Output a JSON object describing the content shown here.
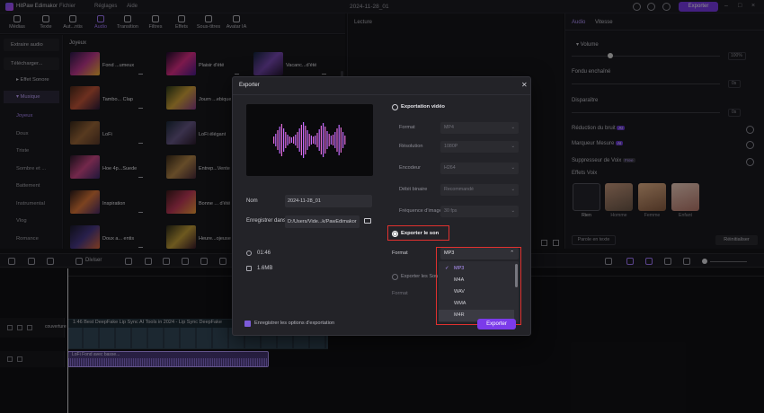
{
  "app": {
    "name": "HitPaw Edimakor",
    "menus": [
      "Fichier",
      "Réglages",
      "Aide"
    ],
    "document_title": "2024-11-28_01",
    "export_button": "Exporter"
  },
  "toolbar": {
    "tools": [
      {
        "label": "Médias",
        "icon": "media-icon"
      },
      {
        "label": "Texte",
        "icon": "text-icon"
      },
      {
        "label": "Aut...ntis",
        "icon": "auto-subtitle-icon"
      },
      {
        "label": "Audio",
        "icon": "music-note-icon",
        "active": true
      },
      {
        "label": "Transition",
        "icon": "transition-icon"
      },
      {
        "label": "Filtres",
        "icon": "filter-icon"
      },
      {
        "label": "Effets",
        "icon": "effects-icon"
      },
      {
        "label": "Sous-titres",
        "icon": "subtitles-icon"
      },
      {
        "label": "Avatar IA",
        "icon": "avatar-icon"
      }
    ]
  },
  "categories": {
    "items": [
      "Extraire audio",
      "Télécharger...",
      "Effet Sonore",
      "Musique",
      "Joyeux",
      "Doux",
      "Triste",
      "Sombre et ...",
      "Battement",
      "Instrumental",
      "Vlog",
      "Romance"
    ]
  },
  "grid": {
    "header": "Joyeux",
    "items": [
      "Fond ...umeux",
      "Plaisir d'été",
      "Vacanc...d'été",
      "Tambo... Clap",
      "Journ ...ebique",
      "Upbea... Rock",
      "LoFi",
      "LoFi élégant",
      "Hip Ho...nctuel",
      "Hoe 4p...Suede",
      "Entrep...Vente",
      "Funky... Jovial",
      "Inspiration",
      "Bonne ... d'été",
      "Vibrant... Happy",
      "Doux a... entis",
      "Heure...ojeuse",
      "Rythm ... Jouir"
    ]
  },
  "player": {
    "label": "Lecture"
  },
  "props": {
    "tabs": [
      "Audio",
      "Vitesse"
    ],
    "volume_label": "Volume",
    "volume_value": "100%",
    "fade_in_label": "Fondu enchaîné",
    "fade_in_value": "0s",
    "fade_out_label": "Disparaître",
    "fade_out_value": "0s",
    "noise_label": "Réduction du bruit",
    "beat_label": "Marqueur Mesure",
    "voice_remove_label": "Suppresseur de Voix",
    "voice_effects_label": "Effets Voix",
    "free_tag": "Free",
    "ai_tag": "AI",
    "voices": [
      "Rien",
      "Homme",
      "Femme",
      "Enfant"
    ],
    "text_to_speech": "Parole en texte",
    "reset": "Réinitialiser"
  },
  "timeline": {
    "tool_label": "Diviser",
    "clip_title": "1:46 Best DeepFake Lip Sync AI Tools in 2024 - Lip Sync DeepFake",
    "audio_clip_title": "LoFi Fond avec basse...",
    "track_label": "couverture"
  },
  "dialog": {
    "title": "Exporter",
    "name_label": "Nom",
    "name_value": "2024-11-28_01",
    "save_label": "Enregistrer dans",
    "save_value": "D:/Users/Vide...k/PawEdimakor",
    "duration": "01:46",
    "size": "1.6MB",
    "remember": "Enregistrer les options d'exportation",
    "video_section": "Exportation vidéo",
    "video_options": [
      {
        "label": "Format",
        "value": "MP4"
      },
      {
        "label": "Résolution",
        "value": "1080P"
      },
      {
        "label": "Encodeur",
        "value": "H264"
      },
      {
        "label": "Débit binaire",
        "value": "Recommandé"
      },
      {
        "label": "Fréquence d'image",
        "value": "30 fps"
      }
    ],
    "audio_section": "Exporter le son",
    "audio_format_label": "Format",
    "audio_format_value": "MP3",
    "audio_formats": [
      "MP3",
      "M4A",
      "WAV",
      "WMA",
      "M4R"
    ],
    "sound_only_label": "Exporter les Sou",
    "sound_only_format_label": "Format",
    "export_button": "Exporter"
  },
  "colors": {
    "accent": "#7b3bea",
    "highlight": "#e0312f"
  }
}
